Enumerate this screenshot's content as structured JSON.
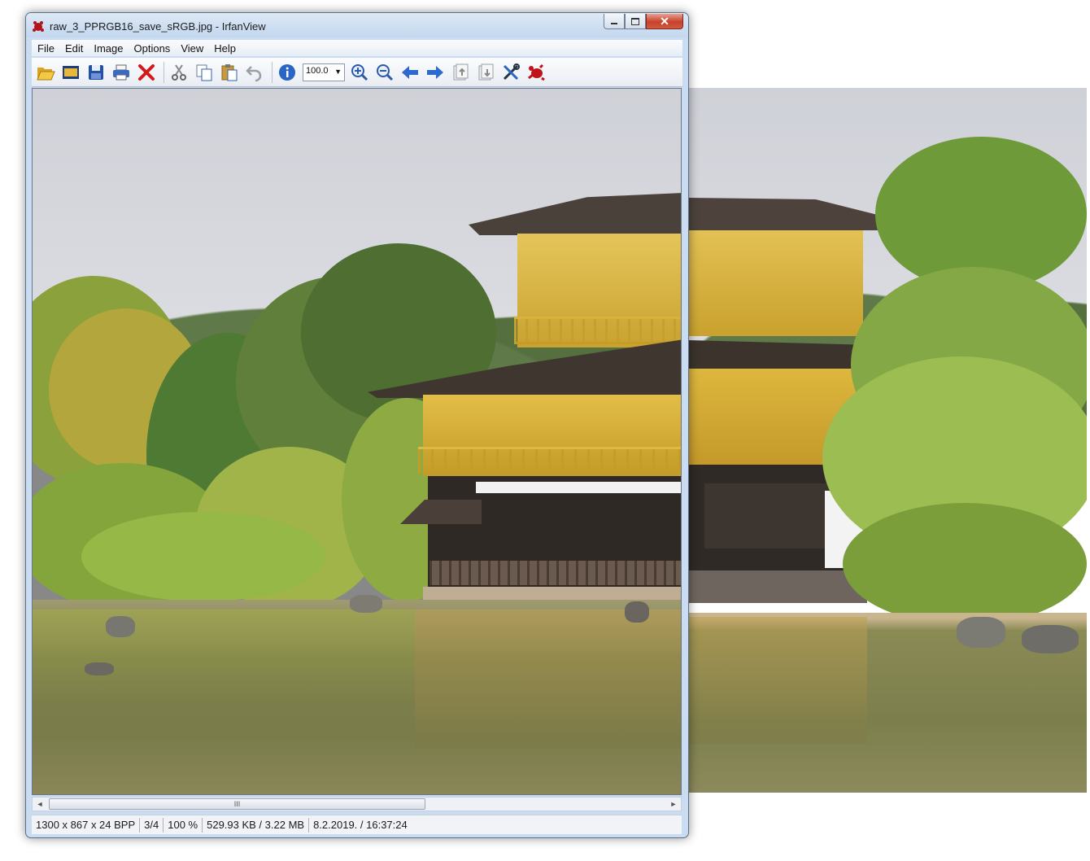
{
  "window": {
    "title": "raw_3_PPRGB16_save_sRGB.jpg - IrfanView",
    "caption_buttons": {
      "minimize": "minimize-icon",
      "maximize": "maximize-icon",
      "close": "close-icon"
    }
  },
  "menu": [
    "File",
    "Edit",
    "Image",
    "Options",
    "View",
    "Help"
  ],
  "toolbar": {
    "zoom_value": "100.0",
    "buttons": [
      "open-folder-icon",
      "slideshow-icon",
      "save-icon",
      "print-icon",
      "delete-icon",
      "cut-icon",
      "copy-icon",
      "paste-icon",
      "undo-icon",
      "info-icon",
      "zoom-in-icon",
      "zoom-out-icon",
      "previous-arrow-icon",
      "next-arrow-icon",
      "first-page-icon",
      "last-page-icon",
      "settings-tools-icon",
      "irfanview-logo-icon"
    ]
  },
  "statusbar": {
    "dimensions": "1300 x 867 x 24 BPP",
    "index": "3/4",
    "zoom": "100 %",
    "size": "529.93 KB / 3.22 MB",
    "datetime": "8.2.2019. / 16:37:24"
  },
  "scroll": {
    "horizontal_grip": "III"
  },
  "colors": {
    "titlebar": "#c9dcf1",
    "close_button": "#c7412a",
    "pavilion_gold": "#d8b33a",
    "roof": "#4a413b",
    "sky": "#d6d7dd",
    "water": "#7c7f4c"
  }
}
